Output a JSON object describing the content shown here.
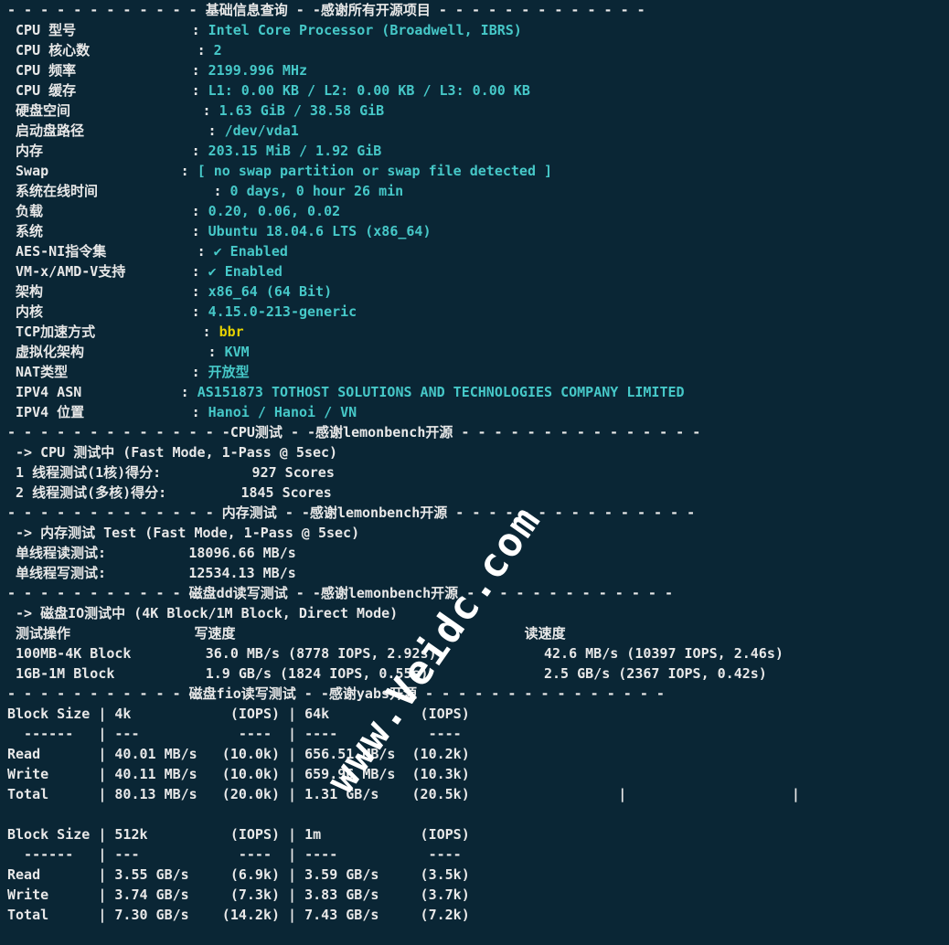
{
  "hdr1": "- - - - - - - - - - - - 基础信息查询 - -感谢所有开源项目 - - - - - - - - - - - - -",
  "info": [
    {
      "k": "CPU 型号",
      "v": "Intel Core Processor (Broadwell, IBRS)",
      "c": "cy"
    },
    {
      "k": "CPU 核心数",
      "v": "2",
      "c": "cy"
    },
    {
      "k": "CPU 频率",
      "v": "2199.996 MHz",
      "c": "cy"
    },
    {
      "k": "CPU 缓存",
      "v": "L1: 0.00 KB / L2: 0.00 KB / L3: 0.00 KB",
      "c": "cy"
    },
    {
      "k": "硬盘空间",
      "v": "1.63 GiB / 38.58 GiB",
      "c": "cy"
    },
    {
      "k": "启动盘路径",
      "v": "/dev/vda1",
      "c": "cy"
    },
    {
      "k": "内存",
      "v": "203.15 MiB / 1.92 GiB",
      "c": "cy"
    },
    {
      "k": "Swap",
      "v": "[ no swap partition or swap file detected ]",
      "c": "cy"
    },
    {
      "k": "系统在线时间",
      "v": "0 days, 0 hour 26 min",
      "c": "cy"
    },
    {
      "k": "负载",
      "v": "0.20, 0.06, 0.02",
      "c": "cy"
    },
    {
      "k": "系统",
      "v": "Ubuntu 18.04.6 LTS (x86_64)",
      "c": "cy"
    },
    {
      "k": "AES-NI指令集",
      "v": "✔ Enabled",
      "c": "cy"
    },
    {
      "k": "VM-x/AMD-V支持",
      "v": "✔ Enabled",
      "c": "cy"
    },
    {
      "k": "架构",
      "v": "x86_64 (64 Bit)",
      "c": "cy"
    },
    {
      "k": "内核",
      "v": "4.15.0-213-generic",
      "c": "cy"
    },
    {
      "k": "TCP加速方式",
      "v": "bbr",
      "c": "yl"
    },
    {
      "k": "虚拟化架构",
      "v": "KVM",
      "c": "cy"
    },
    {
      "k": "NAT类型",
      "v": "开放型",
      "c": "cy"
    },
    {
      "k": "IPV4 ASN",
      "v": "AS151873 TOTHOST SOLUTIONS AND TECHNOLOGIES COMPANY LIMITED",
      "c": "cy"
    },
    {
      "k": "IPV4 位置",
      "v": "Hanoi / Hanoi / VN",
      "c": "cy"
    }
  ],
  "hdr2": "- - - - - - - - - - - - - -CPU测试 - -感谢lemonbench开源 - - - - - - - - - - - - - - -",
  "cpu_mode": " -> CPU 测试中 (Fast Mode, 1-Pass @ 5sec)",
  "cpu_r1": " 1 线程测试(1核)得分:           927 Scores",
  "cpu_r2": " 2 线程测试(多核)得分:         1845 Scores",
  "hdr3": "- - - - - - - - - - - - - 内存测试 - -感谢lemonbench开源 - - - - - - - - - - - - - - -",
  "mem_mode": " -> 内存测试 Test (Fast Mode, 1-Pass @ 5sec)",
  "mem_r1": " 单线程读测试:          18096.66 MB/s",
  "mem_r2": " 单线程写测试:          12534.13 MB/s",
  "hdr4": "- - - - - - - - - - - 磁盘dd读写测试 - -感谢lemonbench开源 - - - - - - - - - - - - -",
  "dd_mode": " -> 磁盘IO测试中 (4K Block/1M Block, Direct Mode)",
  "dd_hdr": " 测试操作               写速度                                   读速度",
  "dd_r1": " 100MB-4K Block         36.0 MB/s (8778 IOPS, 2.92s)             42.6 MB/s (10397 IOPS, 2.46s)",
  "dd_r2": " 1GB-1M Block           1.9 GB/s (1824 IOPS, 0.55s)              2.5 GB/s (2367 IOPS, 0.42s)",
  "hdr5": "- - - - - - - - - - - 磁盘fio读写测试 - -感谢yabs开源 - - - - - - - - - - - - - - -",
  "fio1": [
    "Block Size | 4k            (IOPS) | 64k           (IOPS)",
    "  ------   | ---            ----  | ----           ---- ",
    "Read       | 40.01 MB/s   (10.0k) | 656.51 MB/s  (10.2k)",
    "Write      | 40.11 MB/s   (10.0k) | 659.96 MB/s  (10.3k)",
    "Total      | 80.13 MB/s   (20.0k) | 1.31 GB/s    (20.5k)                  |                    |"
  ],
  "fio2": [
    "Block Size | 512k          (IOPS) | 1m            (IOPS)",
    "  ------   | ---            ----  | ----           ---- ",
    "Read       | 3.55 GB/s     (6.9k) | 3.59 GB/s     (3.5k)",
    "Write      | 3.74 GB/s     (7.3k) | 3.83 GB/s     (3.7k)",
    "Total      | 7.30 GB/s    (14.2k) | 7.43 GB/s     (7.2k)"
  ],
  "watermark": "www.Veidc.com"
}
